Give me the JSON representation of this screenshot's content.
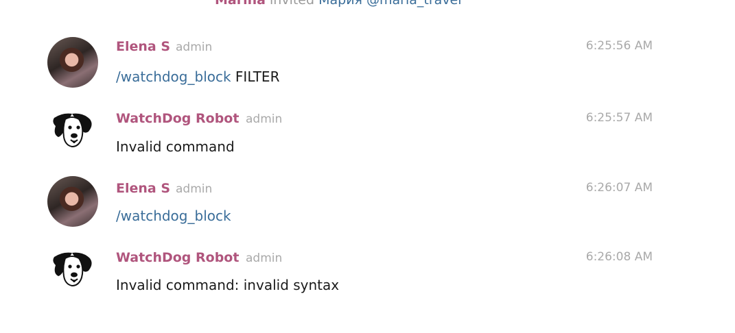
{
  "service": {
    "actor": "Marina",
    "action": "invited",
    "target": "Мария @maria_travel"
  },
  "messages": [
    {
      "author": "Elena S",
      "role": "admin",
      "time": "6:25:56 AM",
      "command": "/watchdog_block",
      "text": " FILTER",
      "avatar": "photo"
    },
    {
      "author": "WatchDog Robot",
      "role": "admin",
      "time": "6:25:57 AM",
      "command": "",
      "text": "Invalid command",
      "avatar": "dog-icon"
    },
    {
      "author": "Elena S",
      "role": "admin",
      "time": "6:26:07 AM",
      "command": "/watchdog_block",
      "text": "",
      "avatar": "photo"
    },
    {
      "author": "WatchDog Robot",
      "role": "admin",
      "time": "6:26:08 AM",
      "command": "",
      "text": "Invalid command: invalid syntax",
      "avatar": "dog-icon"
    }
  ]
}
